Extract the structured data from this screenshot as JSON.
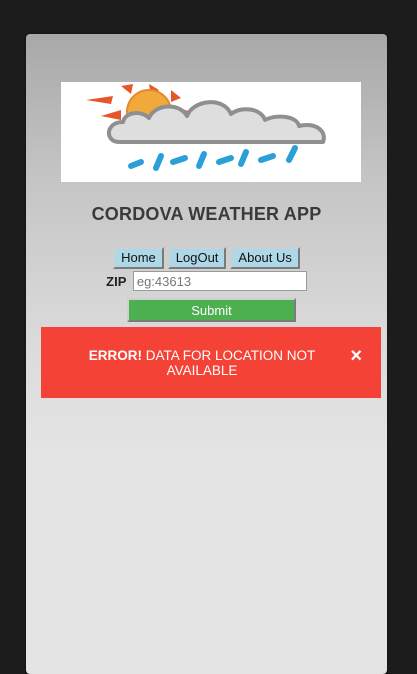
{
  "app": {
    "title": "CORDOVA WEATHER APP"
  },
  "logo": {
    "icon": "weather-rain-sun-icon",
    "colors": {
      "sun": "#f2a93b",
      "sun_rays": "#e5562a",
      "cloud": "#d9d9d9",
      "cloud_outline": "#8f8f8f",
      "rain": "#2a9fd8"
    }
  },
  "nav": {
    "home_label": "Home",
    "logout_label": "LogOut",
    "about_label": "About Us",
    "button_color": "#aed8e8"
  },
  "form": {
    "zip_label": "ZIP",
    "zip_placeholder": "eg:43613",
    "zip_value": "",
    "submit_label": "Submit",
    "submit_color": "#4caf50"
  },
  "alert": {
    "strong": "ERROR!",
    "message": " DATA FOR LOCATION NOT AVAILABLE",
    "close_symbol": "×",
    "color": "#f44336"
  }
}
